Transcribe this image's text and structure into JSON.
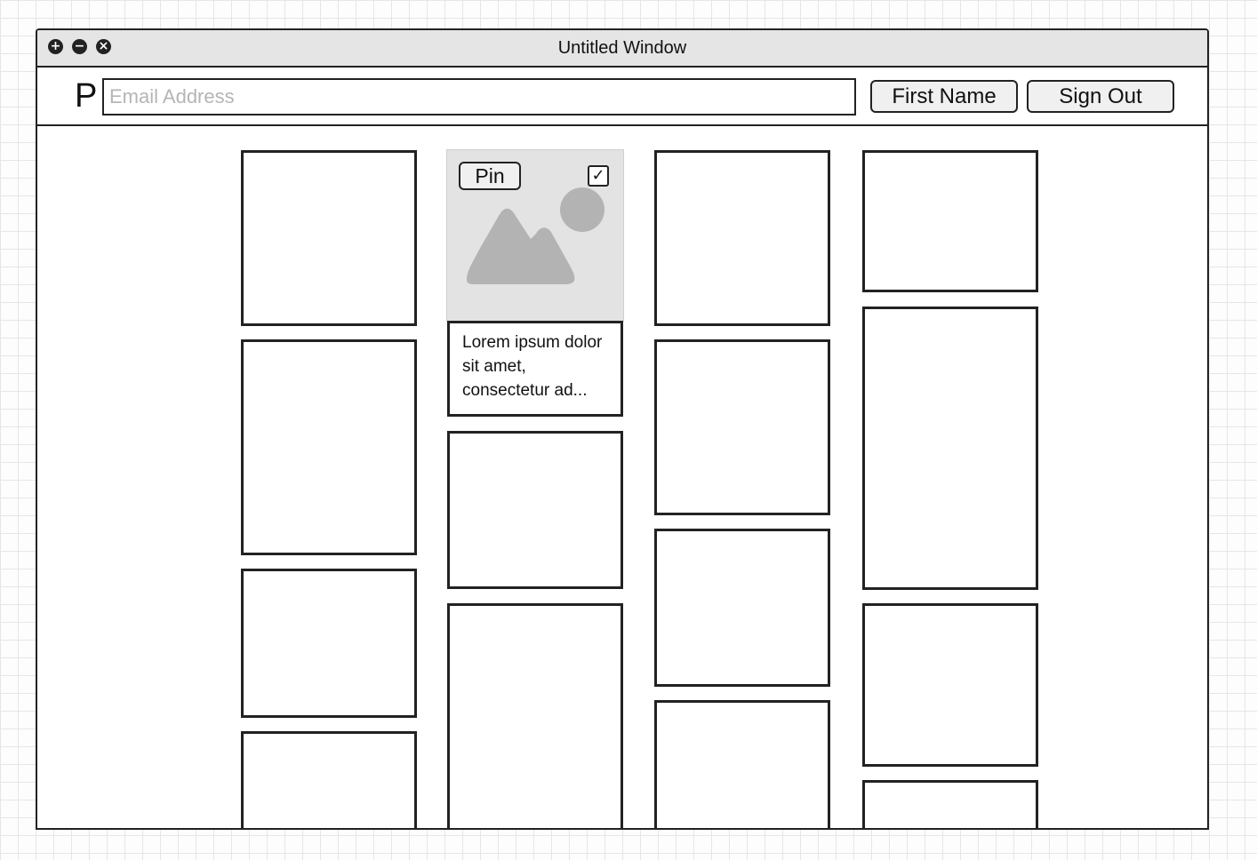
{
  "window": {
    "title": "Untitled Window",
    "controls": [
      "+",
      "−",
      "×"
    ]
  },
  "toolbar": {
    "logo": "P",
    "search_placeholder": "Email Address",
    "search_value": "",
    "first_name_label": "First Name",
    "sign_out_label": "Sign Out"
  },
  "pin_card": {
    "pin_label": "Pin",
    "checked": true,
    "check_glyph": "✓",
    "image_icon": "image-placeholder-icon",
    "caption": "Lorem ipsum dolor sit amet, consectetur ad..."
  },
  "colors": {
    "border": "#222222",
    "image_bg": "#e3e3e3",
    "image_glyph": "#b3b3b3",
    "titlebar_bg": "#e5e5e5"
  }
}
